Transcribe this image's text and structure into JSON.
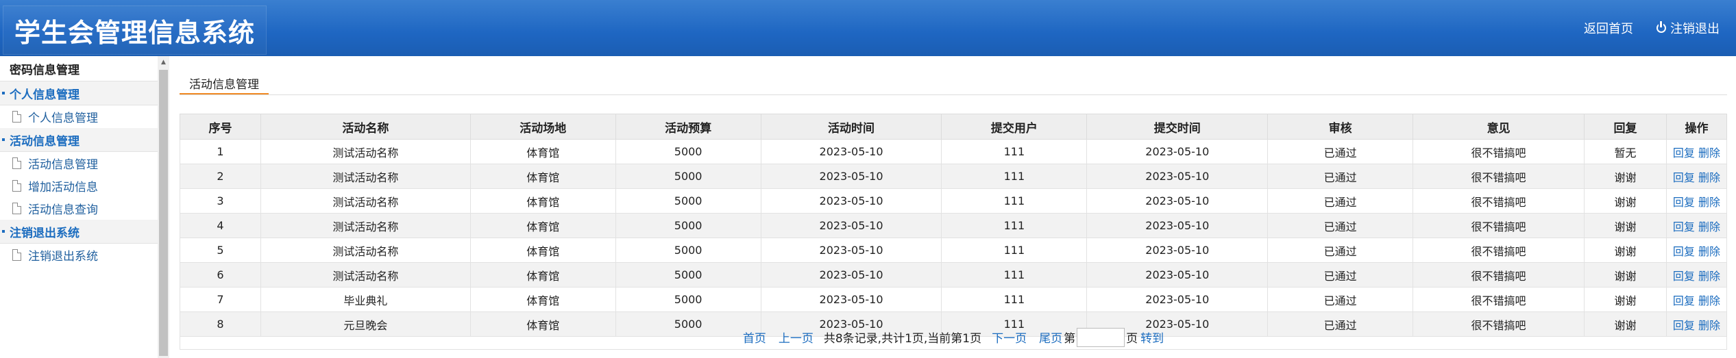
{
  "header": {
    "title": "学生会管理信息系统",
    "home_link": "返回首页",
    "logout_link": "注销退出"
  },
  "sidebar": {
    "top": "密码信息管理",
    "groups": [
      {
        "title": "个人信息管理",
        "items": [
          "个人信息管理"
        ]
      },
      {
        "title": "活动信息管理",
        "items": [
          "活动信息管理",
          "增加活动信息",
          "活动信息查询"
        ]
      },
      {
        "title": "注销退出系统",
        "items": [
          "注销退出系统"
        ]
      }
    ]
  },
  "main": {
    "tab": "活动信息管理",
    "columns": [
      "序号",
      "活动名称",
      "活动场地",
      "活动预算",
      "活动时间",
      "提交用户",
      "提交时间",
      "审核",
      "意见",
      "回复",
      "操作"
    ],
    "rows": [
      {
        "no": "1",
        "name": "测试活动名称",
        "venue": "体育馆",
        "budget": "5000",
        "time": "2023-05-10",
        "user": "111",
        "submit": "2023-05-10",
        "audit": "已通过",
        "opinion": "很不错搞吧",
        "reply": "暂无"
      },
      {
        "no": "2",
        "name": "测试活动名称",
        "venue": "体育馆",
        "budget": "5000",
        "time": "2023-05-10",
        "user": "111",
        "submit": "2023-05-10",
        "audit": "已通过",
        "opinion": "很不错搞吧",
        "reply": "谢谢"
      },
      {
        "no": "3",
        "name": "测试活动名称",
        "venue": "体育馆",
        "budget": "5000",
        "time": "2023-05-10",
        "user": "111",
        "submit": "2023-05-10",
        "audit": "已通过",
        "opinion": "很不错搞吧",
        "reply": "谢谢"
      },
      {
        "no": "4",
        "name": "测试活动名称",
        "venue": "体育馆",
        "budget": "5000",
        "time": "2023-05-10",
        "user": "111",
        "submit": "2023-05-10",
        "audit": "已通过",
        "opinion": "很不错搞吧",
        "reply": "谢谢"
      },
      {
        "no": "5",
        "name": "测试活动名称",
        "venue": "体育馆",
        "budget": "5000",
        "time": "2023-05-10",
        "user": "111",
        "submit": "2023-05-10",
        "audit": "已通过",
        "opinion": "很不错搞吧",
        "reply": "谢谢"
      },
      {
        "no": "6",
        "name": "测试活动名称",
        "venue": "体育馆",
        "budget": "5000",
        "time": "2023-05-10",
        "user": "111",
        "submit": "2023-05-10",
        "audit": "已通过",
        "opinion": "很不错搞吧",
        "reply": "谢谢"
      },
      {
        "no": "7",
        "name": "毕业典礼",
        "venue": "体育馆",
        "budget": "5000",
        "time": "2023-05-10",
        "user": "111",
        "submit": "2023-05-10",
        "audit": "已通过",
        "opinion": "很不错搞吧",
        "reply": "谢谢"
      },
      {
        "no": "8",
        "name": "元旦晚会",
        "venue": "体育馆",
        "budget": "5000",
        "time": "2023-05-10",
        "user": "111",
        "submit": "2023-05-10",
        "audit": "已通过",
        "opinion": "很不错搞吧",
        "reply": "谢谢"
      }
    ],
    "row_actions": {
      "reply": "回复",
      "delete": "删除"
    },
    "pager": {
      "first": "首页",
      "prev": "上一页",
      "summary": "共8条记录,共计1页,当前第1页",
      "next": "下一页",
      "last": "尾页",
      "page_prefix": "第",
      "page_input_value": "",
      "page_suffix": "页",
      "go": "转到"
    }
  }
}
